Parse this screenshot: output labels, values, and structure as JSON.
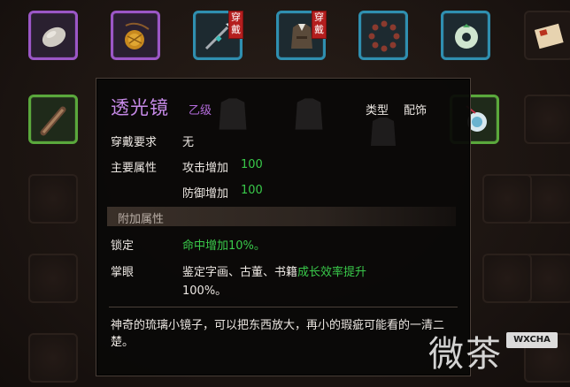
{
  "inventory": {
    "slots": [
      {
        "name": "slot-1",
        "icon": "stone-icon",
        "rarity": "purple"
      },
      {
        "name": "slot-2",
        "icon": "gourd-pouch-icon",
        "rarity": "purple"
      },
      {
        "name": "slot-3",
        "icon": "spear-icon",
        "rarity": "cyan",
        "tag": "穿戴"
      },
      {
        "name": "slot-4",
        "icon": "robe-armor-icon",
        "rarity": "cyan",
        "tag": "穿戴"
      },
      {
        "name": "slot-5",
        "icon": "prayer-beads-icon",
        "rarity": "cyan"
      },
      {
        "name": "slot-6",
        "icon": "jade-ring-icon",
        "rarity": "cyan"
      },
      {
        "name": "slot-7",
        "icon": "scroll-icon",
        "rarity": "none"
      },
      {
        "name": "slot-8",
        "icon": "rolled-scroll-icon",
        "rarity": "green"
      },
      {
        "name": "slot-9",
        "icon": "magnifier-pendant-icon",
        "rarity": "green"
      }
    ]
  },
  "tooltip": {
    "title": "透光镜",
    "grade": "乙级",
    "type_label": "类型",
    "type_value": "配饰",
    "wear_req_label": "穿戴要求",
    "wear_req_value": "无",
    "main_attr_label": "主要属性",
    "attack_label": "攻击增加",
    "attack_value": "100",
    "defense_label": "防御增加",
    "defense_value": "100",
    "extra_attr_label": "附加属性",
    "lock_label": "锁定",
    "lock_value": "命中增加10%。",
    "eye_label": "掌眼",
    "eye_text_1": "鉴定字画、古董、书籍",
    "eye_text_green": "成长效率提升",
    "eye_text_2": "100%。",
    "description": "神奇的琉璃小镜子，可以把东西放大，再小的瑕疵可能看的一清二楚。"
  },
  "watermark": {
    "text": "微茶",
    "badge": "WXCHA"
  },
  "colors": {
    "purple_border": "#9b57c6",
    "cyan_border": "#2f8fb0",
    "green_border": "#5aa83c",
    "title_purple": "#c78ae8",
    "stat_green": "#39c94a",
    "tag_red": "#b41e1e"
  }
}
